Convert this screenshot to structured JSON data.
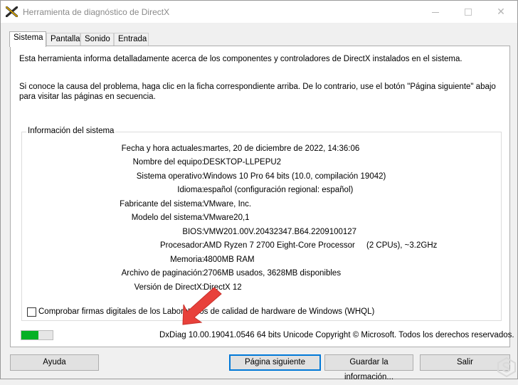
{
  "window": {
    "title": "Herramienta de diagnóstico de DirectX",
    "close_glyph": "✕"
  },
  "tabs": [
    {
      "label": "Sistema",
      "active": true
    },
    {
      "label": "Pantalla"
    },
    {
      "label": "Sonido"
    },
    {
      "label": "Entrada"
    }
  ],
  "intro": {
    "line1": "Esta herramienta informa detalladamente acerca de los componentes y controladores de DirectX instalados en el sistema.",
    "line2": "Si conoce la causa del problema, haga clic en la ficha correspondiente arriba. De lo contrario, use el botón \"Página siguiente\" abajo para visitar las páginas en secuencia."
  },
  "system_info": {
    "group_title": "Información del sistema",
    "rows": [
      {
        "label": "Fecha y hora actuales:",
        "value": "martes, 20 de diciembre de 2022, 14:36:06"
      },
      {
        "label": "Nombre del equipo:",
        "value": "DESKTOP-LLPEPU2"
      },
      {
        "label": "Sistema operativo:",
        "value": "Windows 10 Pro 64 bits (10.0, compilación 19042)"
      },
      {
        "label": "Idioma:",
        "value": "español (configuración regional: español)"
      },
      {
        "label": "Fabricante del sistema:",
        "value": "VMware, Inc."
      },
      {
        "label": "Modelo del sistema:",
        "value": "VMware20,1"
      },
      {
        "label": "BIOS:",
        "value": "VMW201.00V.20432347.B64.2209100127"
      },
      {
        "label": "Procesador:",
        "value": "AMD Ryzen 7 2700 Eight-Core Processor",
        "extra": "(2 CPUs), ~3.2GHz"
      },
      {
        "label": "Memoria:",
        "value": "4800MB RAM"
      },
      {
        "label": "Archivo de paginación:",
        "value": "2706MB usados, 3628MB disponibles"
      },
      {
        "label": "Versión de DirectX:",
        "value": "DirectX 12"
      }
    ]
  },
  "whql_checkbox": {
    "label": "Comprobar firmas digitales de los Laboratorios de calidad de hardware de Windows (WHQL)",
    "checked": false
  },
  "progress": 0.55,
  "copyright": "DxDiag 10.00.19041.0546 64 bits Unicode  Copyright © Microsoft. Todos los derechos reservados.",
  "buttons": {
    "help": "Ayuda",
    "next": "Página siguiente",
    "save": "Guardar la información...",
    "exit": "Salir"
  },
  "colors": {
    "progress_fill": "#06b025",
    "default_button_border": "#0078d7",
    "annotation_arrow": "#e8413b"
  },
  "icons": {
    "app": "directx-x-icon",
    "annotation": "red-arrow-icon",
    "watermark": "solvetic-logo-icon"
  }
}
